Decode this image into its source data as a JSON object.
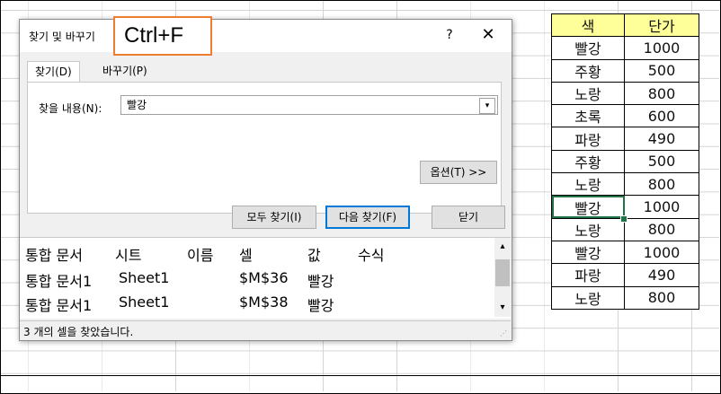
{
  "dialog": {
    "title": "찾기 및 바꾸기",
    "help": "?",
    "close": "✕",
    "callout": "Ctrl+F",
    "tabs": {
      "find": "찾기(D)",
      "replace": "바꾸기(P)"
    },
    "find_label": "찾을 내용(N):",
    "find_value": "빨강",
    "options_label": "옵션(T) >>",
    "find_all_label": "모두 찾기(I)",
    "find_next_label": "다음 찾기(F)",
    "close_label": "닫기",
    "results": {
      "headers": [
        "통합 문서",
        "시트",
        "이름",
        "셀",
        "값",
        "수식"
      ],
      "rows": [
        [
          "통합 문서1",
          "Sheet1",
          "",
          "$M$36",
          "빨강",
          ""
        ],
        [
          "통합 문서1",
          "Sheet1",
          "",
          "$M$38",
          "빨강",
          ""
        ]
      ]
    },
    "status": "3 개의 셀을 찾았습니다."
  },
  "sheet": {
    "headers": [
      "색",
      "단가"
    ],
    "rows": [
      [
        "빨강",
        "1000"
      ],
      [
        "주황",
        "500"
      ],
      [
        "노랑",
        "800"
      ],
      [
        "초록",
        "600"
      ],
      [
        "파랑",
        "490"
      ],
      [
        "주황",
        "500"
      ],
      [
        "노랑",
        "800"
      ],
      [
        "빨강",
        "1000"
      ],
      [
        "노랑",
        "800"
      ],
      [
        "빨강",
        "1000"
      ],
      [
        "파랑",
        "490"
      ],
      [
        "노랑",
        "800"
      ]
    ]
  },
  "colors": {
    "header_fill": "#ffff99",
    "callout_border": "#ed7d31",
    "active_cell": "#217346",
    "focus_button": "#0078d7"
  }
}
